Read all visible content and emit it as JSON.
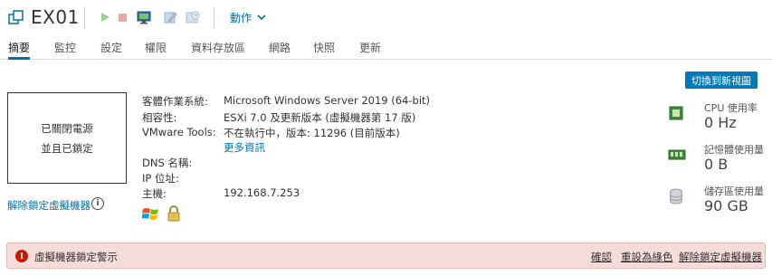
{
  "header": {
    "title": "EX01",
    "actions_label": "動作"
  },
  "tabs": [
    {
      "label": "摘要"
    },
    {
      "label": "監控"
    },
    {
      "label": "設定"
    },
    {
      "label": "權限"
    },
    {
      "label": "資料存放區"
    },
    {
      "label": "網路"
    },
    {
      "label": "快照"
    },
    {
      "label": "更新"
    }
  ],
  "switch_view_label": "切換到新視圖",
  "console": {
    "line1": "已關閉電源",
    "line2": "並且已鎖定"
  },
  "unlock_link": "解除鎖定虛擬機器",
  "details": {
    "os_label": "客體作業系統:",
    "os_value": "Microsoft Windows Server 2019 (64-bit)",
    "compat_label": "相容性:",
    "compat_value": "ESXi 7.0 及更新版本 (虛擬機器第 17 版)",
    "tools_label": "VMware Tools:",
    "tools_value": "不在執行中，版本: 11296 (目前版本)",
    "more_info": "更多資訊",
    "dns_label": "DNS 名稱:",
    "ip_label": "IP 位址:",
    "host_label": "主機:",
    "host_value": "192.168.7.253"
  },
  "resources": {
    "cpu_label": "CPU 使用率",
    "cpu_value": "0 Hz",
    "mem_label": "記憶體使用量",
    "mem_value": "0 B",
    "storage_label": "儲存區使用量",
    "storage_value": "90 GB"
  },
  "alert": {
    "message": "虛擬機器鎖定警示",
    "confirm": "確認",
    "reset_green": "重設為綠色",
    "unlock": "解除鎖定虛擬機器"
  },
  "colors": {
    "accent": "#0072a3",
    "alert_bg": "#f5dbd9",
    "alert_icon": "#c21d00"
  }
}
